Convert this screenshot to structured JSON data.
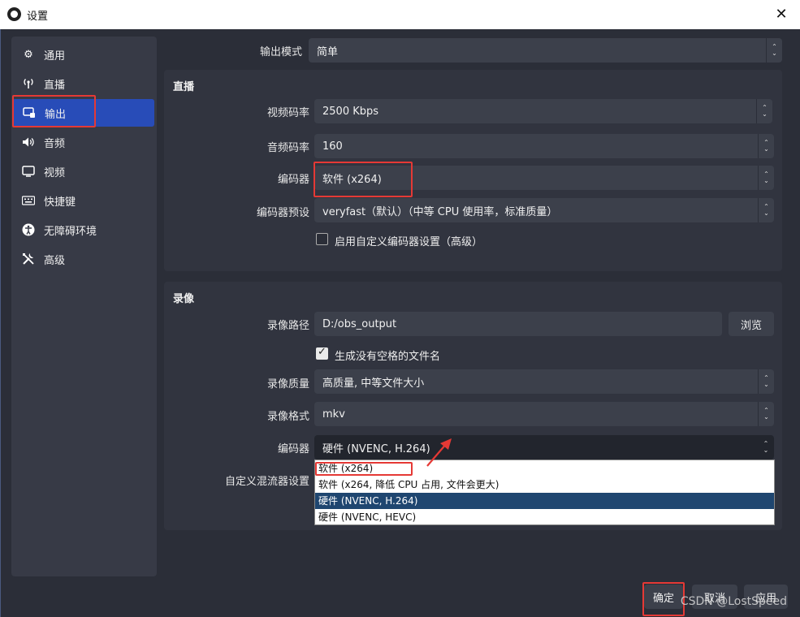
{
  "window": {
    "title": "设置",
    "close_glyph": "✕"
  },
  "sidebar": {
    "items": [
      {
        "label": "通用",
        "icon": "gear-icon"
      },
      {
        "label": "直播",
        "icon": "antenna-icon"
      },
      {
        "label": "输出",
        "icon": "output-icon"
      },
      {
        "label": "音频",
        "icon": "speaker-icon"
      },
      {
        "label": "视频",
        "icon": "monitor-icon"
      },
      {
        "label": "快捷键",
        "icon": "keyboard-icon"
      },
      {
        "label": "无障碍环境",
        "icon": "accessibility-icon"
      },
      {
        "label": "高级",
        "icon": "tools-icon"
      }
    ],
    "active_index": 2
  },
  "output_mode": {
    "label": "输出模式",
    "value": "简单"
  },
  "streaming": {
    "title": "直播",
    "video_bitrate": {
      "label": "视频码率",
      "value": "2500 Kbps"
    },
    "audio_bitrate": {
      "label": "音频码率",
      "value": "160"
    },
    "encoder": {
      "label": "编码器",
      "value": "软件 (x264)"
    },
    "preset": {
      "label": "编码器预设",
      "value": "veryfast（默认）（中等 CPU 使用率，标准质量）"
    },
    "custom_encoder": {
      "label": "启用自定义编码器设置（高级）",
      "checked": false
    }
  },
  "recording": {
    "title": "录像",
    "path": {
      "label": "录像路径",
      "value": "D:/obs_output",
      "browse": "浏览"
    },
    "no_space": {
      "label": "生成没有空格的文件名",
      "checked": true
    },
    "quality": {
      "label": "录像质量",
      "value": "高质量, 中等文件大小"
    },
    "format": {
      "label": "录像格式",
      "value": "mkv"
    },
    "encoder": {
      "label": "编码器",
      "value": "硬件 (NVENC, H.264)"
    },
    "muxer": {
      "label": "自定义混流器设置"
    },
    "encoder_options": [
      "软件 (x264)",
      "软件 (x264, 降低 CPU 占用, 文件会更大)",
      "硬件 (NVENC, H.264)",
      "硬件 (NVENC, HEVC)"
    ],
    "highlighted_option": 2
  },
  "footer": {
    "ok": "确定",
    "cancel": "取消",
    "apply": "应用"
  },
  "watermark": "CSDN @LostSpeed",
  "colors": {
    "accent": "#284cb8",
    "annotation": "#e53935"
  }
}
